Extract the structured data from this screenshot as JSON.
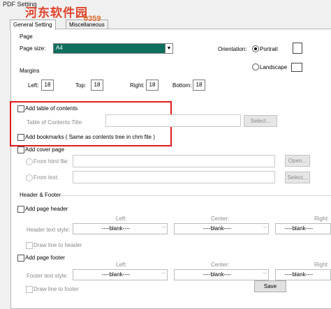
{
  "window": {
    "title": "PDF Setting"
  },
  "watermark": {
    "text": "河东软件园",
    "sub": "0359"
  },
  "tabs": [
    {
      "label": "General Setting"
    },
    {
      "label": "Miscellaneous"
    }
  ],
  "page": {
    "section": "Page",
    "page_size_label": "Page size:",
    "page_size_value": "A4",
    "orientation_label": "Orientation:",
    "portrait_label": "Portrait",
    "landscape_label": "Landscape",
    "orientation_selected": "Portrait"
  },
  "margins": {
    "section": "Margins",
    "left_label": "Left:",
    "left": "18",
    "top_label": "Top:",
    "top": "18",
    "right_label": "Right:",
    "right": "18",
    "bottom_label": "Bottom:",
    "bottom": "18"
  },
  "toc": {
    "add_label": "Add table of contents",
    "title_label": "Table of Contents Title",
    "select_button": "Select...",
    "bookmarks_label": "Add  bookmarks ( Same as contents tree in chm file )"
  },
  "cover": {
    "add_label": "Add cover page",
    "from_html_label": "From html file:",
    "open_button": "Open...",
    "from_text_label": "From  text:",
    "select_button": "Select..."
  },
  "header_footer": {
    "section": "Header & Footer",
    "add_header_label": "Add page header",
    "col_left": "Left:",
    "col_center": "Center:",
    "col_right": "Right:",
    "header_style_label": "Header text style:",
    "blank": "----blank----",
    "draw_line_header": "Draw line to header",
    "add_footer_label": "Add page footer",
    "footer_style_label": "Footer text style:",
    "draw_line_footer": "Draw line to footer"
  },
  "actions": {
    "save": "Save"
  },
  "highlight_color": "#e01b1b",
  "page_size_bg": "#0e6f5e"
}
